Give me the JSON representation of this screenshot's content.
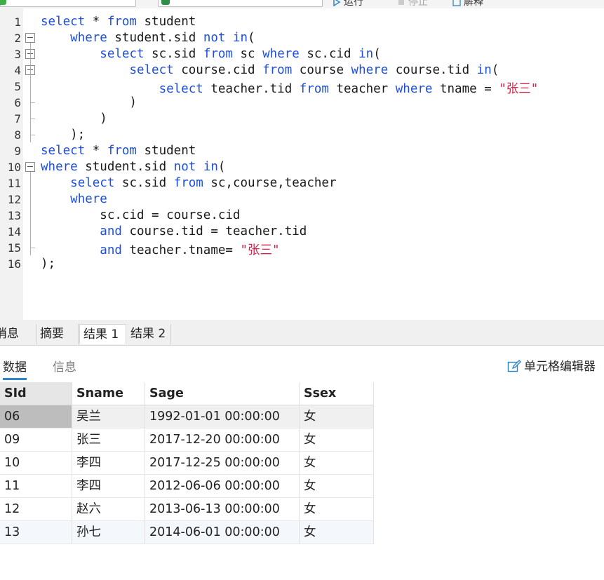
{
  "toolbar": {
    "run_label": "运行",
    "stop_label": "停止",
    "explain_label": "解释"
  },
  "editor": {
    "lines": [
      {
        "num": "1",
        "tokens": [
          [
            "kw",
            "select"
          ],
          [
            "p",
            " * "
          ],
          [
            "kw",
            "from"
          ],
          [
            "p",
            " student"
          ]
        ]
      },
      {
        "num": "2",
        "tokens": [
          [
            "p",
            "    "
          ],
          [
            "kw",
            "where"
          ],
          [
            "p",
            " student.sid "
          ],
          [
            "kw",
            "not"
          ],
          [
            "p",
            " "
          ],
          [
            "kw",
            "in"
          ],
          [
            "p",
            "("
          ]
        ]
      },
      {
        "num": "3",
        "tokens": [
          [
            "p",
            "        "
          ],
          [
            "kw",
            "select"
          ],
          [
            "p",
            " sc.sid "
          ],
          [
            "kw",
            "from"
          ],
          [
            "p",
            " sc "
          ],
          [
            "kw",
            "where"
          ],
          [
            "p",
            " sc.cid "
          ],
          [
            "kw",
            "in"
          ],
          [
            "p",
            "("
          ]
        ]
      },
      {
        "num": "4",
        "tokens": [
          [
            "p",
            "            "
          ],
          [
            "kw",
            "select"
          ],
          [
            "p",
            " course.cid "
          ],
          [
            "kw",
            "from"
          ],
          [
            "p",
            " course "
          ],
          [
            "kw",
            "where"
          ],
          [
            "p",
            " course.tid "
          ],
          [
            "kw",
            "in"
          ],
          [
            "p",
            "("
          ]
        ]
      },
      {
        "num": "5",
        "tokens": [
          [
            "p",
            "                "
          ],
          [
            "kw",
            "select"
          ],
          [
            "p",
            " teacher.tid "
          ],
          [
            "kw",
            "from"
          ],
          [
            "p",
            " teacher "
          ],
          [
            "kw",
            "where"
          ],
          [
            "p",
            " tname = "
          ],
          [
            "str",
            "\"张三\""
          ]
        ]
      },
      {
        "num": "6",
        "tokens": [
          [
            "p",
            "            )"
          ]
        ]
      },
      {
        "num": "7",
        "tokens": [
          [
            "p",
            "        )"
          ]
        ]
      },
      {
        "num": "8",
        "tokens": [
          [
            "p",
            "    );"
          ]
        ]
      },
      {
        "num": "9",
        "tokens": [
          [
            "kw",
            "select"
          ],
          [
            "p",
            " * "
          ],
          [
            "kw",
            "from"
          ],
          [
            "p",
            " student"
          ]
        ]
      },
      {
        "num": "10",
        "tokens": [
          [
            "kw",
            "where"
          ],
          [
            "p",
            " student.sid "
          ],
          [
            "kw",
            "not"
          ],
          [
            "p",
            " "
          ],
          [
            "kw",
            "in"
          ],
          [
            "p",
            "("
          ]
        ]
      },
      {
        "num": "11",
        "tokens": [
          [
            "p",
            "    "
          ],
          [
            "kw",
            "select"
          ],
          [
            "p",
            " sc.sid "
          ],
          [
            "kw",
            "from"
          ],
          [
            "p",
            " sc,course,teacher"
          ]
        ]
      },
      {
        "num": "12",
        "tokens": [
          [
            "p",
            "    "
          ],
          [
            "kw",
            "where"
          ]
        ]
      },
      {
        "num": "13",
        "tokens": [
          [
            "p",
            "        sc.cid = course.cid"
          ]
        ]
      },
      {
        "num": "14",
        "tokens": [
          [
            "p",
            "        "
          ],
          [
            "kw",
            "and"
          ],
          [
            "p",
            " course.tid = teacher.tid"
          ]
        ]
      },
      {
        "num": "15",
        "tokens": [
          [
            "p",
            "        "
          ],
          [
            "kw",
            "and"
          ],
          [
            "p",
            " teacher.tname= "
          ],
          [
            "str",
            "\"张三\""
          ]
        ]
      },
      {
        "num": "16",
        "tokens": [
          [
            "p",
            ");"
          ]
        ]
      }
    ]
  },
  "result_tabs": [
    "消息",
    "摘要",
    "结果 1",
    "结果 2"
  ],
  "result_tabs_active": "结果 1",
  "sub_tabs": {
    "data": "数据",
    "info": "信息"
  },
  "cell_editor_label": "单元格编辑器",
  "table": {
    "columns": [
      "SId",
      "Sname",
      "Sage",
      "Ssex"
    ],
    "rows": [
      [
        "06",
        "吴兰",
        "1992-01-01 00:00:00",
        "女"
      ],
      [
        "09",
        "张三",
        "2017-12-20 00:00:00",
        "女"
      ],
      [
        "10",
        "李四",
        "2017-12-25 00:00:00",
        "女"
      ],
      [
        "11",
        "李四",
        "2012-06-06 00:00:00",
        "女"
      ],
      [
        "12",
        "赵六",
        "2013-06-13 00:00:00",
        "女"
      ],
      [
        "13",
        "孙七",
        "2014-06-01 00:00:00",
        "女"
      ]
    ]
  },
  "colors": {
    "keyword": "#1d4fd8",
    "string": "#d1244b",
    "active_subtab_underline": "#2e86c9"
  }
}
